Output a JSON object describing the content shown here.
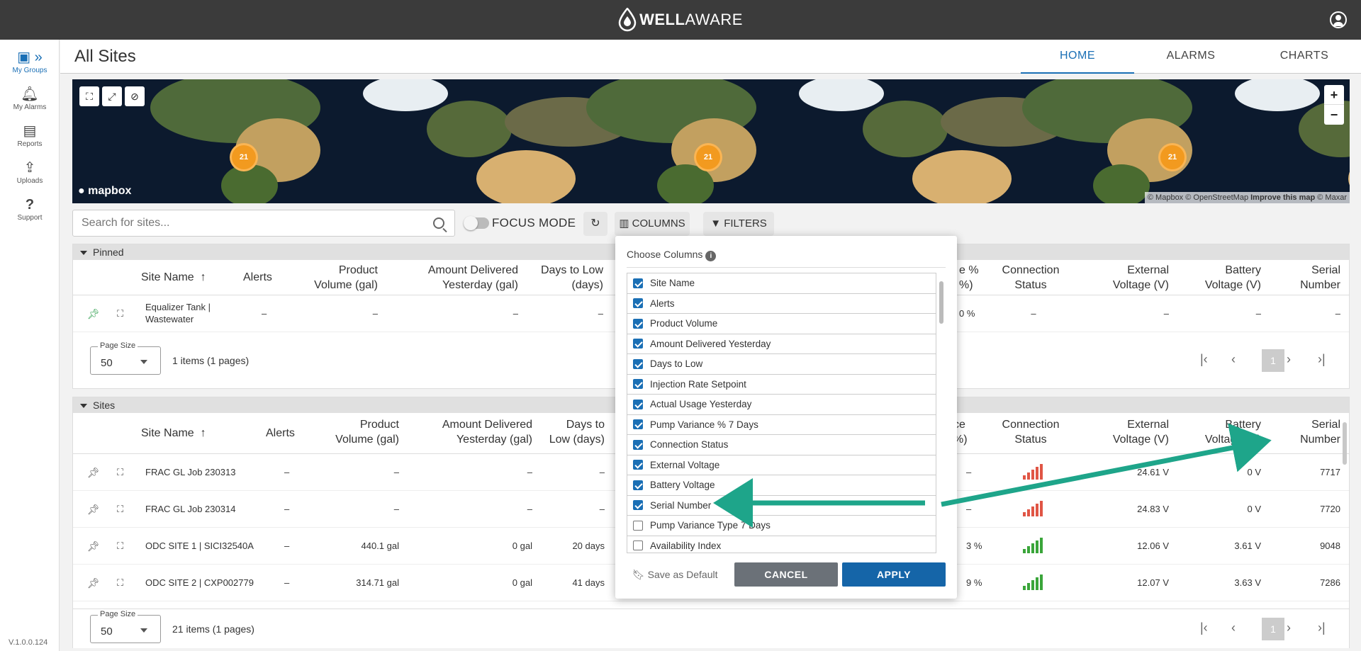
{
  "app": {
    "brand_bold": "WELL",
    "brand_light": "AWARE"
  },
  "sidebar": {
    "items": [
      {
        "label": "My Groups",
        "icon": "groups-icon"
      },
      {
        "label": "My Alarms",
        "icon": "bell-icon"
      },
      {
        "label": "Reports",
        "icon": "document-icon"
      },
      {
        "label": "Uploads",
        "icon": "upload-icon"
      },
      {
        "label": "Support",
        "icon": "question-icon"
      }
    ],
    "version": "V.1.0.0.124"
  },
  "header": {
    "title": "All Sites",
    "tabs": [
      {
        "label": "HOME",
        "active": true
      },
      {
        "label": "ALARMS",
        "active": false
      },
      {
        "label": "CHARTS",
        "active": false
      }
    ]
  },
  "map": {
    "clusters": [
      "21",
      "21",
      "21"
    ],
    "logo": "mapbox",
    "attribution_a": "© Mapbox © OpenStreetMap",
    "attribution_b": "Improve this map",
    "attribution_c": "© Maxar",
    "zoom_in": "+",
    "zoom_out": "−"
  },
  "toolbar": {
    "search_placeholder": "Search for sites...",
    "focus_mode": "FOCUS MODE",
    "columns": "COLUMNS",
    "filters": "FILTERS"
  },
  "pinned": {
    "section": "Pinned",
    "headers": {
      "site_name": "Site Name",
      "alerts": "Alerts",
      "product_volume_1": "Product",
      "product_volume_2": "Volume (gal)",
      "amount_1": "Amount Delivered",
      "amount_2": "Yesterday (gal)",
      "days_1": "Days to Low",
      "days_2": "(days)",
      "pv_1": "e %",
      "pv_2": "%)",
      "conn_1": "Connection",
      "conn_2": "Status",
      "ext_1": "External",
      "ext_2": "Voltage (V)",
      "bat_1": "Battery",
      "bat_2": "Voltage (V)",
      "serial_1": "Serial",
      "serial_2": "Number"
    },
    "rows": [
      {
        "name_1": "Equalizer Tank |",
        "name_2": "Wastewater",
        "alerts": "–",
        "volume": "–",
        "amount": "–",
        "days": "–",
        "pv": "0 %",
        "conn": "–",
        "ext": "–",
        "bat": "–",
        "serial": "–"
      }
    ],
    "page_size_label": "Page Size",
    "page_size": "50",
    "items_info": "1 items (1 pages)",
    "current_page": "1"
  },
  "sites": {
    "section": "Sites",
    "headers": {
      "site_name": "Site Name",
      "alerts": "Alerts",
      "product_volume_1": "Product",
      "product_volume_2": "Volume (gal)",
      "amount_1": "Amount Delivered",
      "amount_2": "Yesterday (gal)",
      "days_1": "Days to",
      "days_2": "Low (days)",
      "pv_1": "ce",
      "pv_2": "%)",
      "conn_1": "Connection",
      "conn_2": "Status",
      "ext_1": "External",
      "ext_2": "Voltage (V)",
      "bat_1": "Battery",
      "bat_2": "Voltage (V)",
      "serial_1": "Serial",
      "serial_2": "Number"
    },
    "rows": [
      {
        "name": "FRAC GL Job 230313",
        "alerts": "–",
        "volume": "–",
        "amount": "–",
        "days": "–",
        "pv": "–",
        "signal": "red",
        "ext": "24.61 V",
        "bat": "0 V",
        "serial": "7717"
      },
      {
        "name": "FRAC GL Job 230314",
        "alerts": "–",
        "volume": "–",
        "amount": "–",
        "days": "–",
        "pv": "–",
        "signal": "red",
        "ext": "24.83 V",
        "bat": "0 V",
        "serial": "7720"
      },
      {
        "name": "ODC SITE 1 | SICI32540A",
        "alerts": "–",
        "volume": "440.1 gal",
        "amount": "0 gal",
        "days": "20 days",
        "pv": "3 %",
        "signal": "green",
        "ext": "12.06 V",
        "bat": "3.61 V",
        "serial": "9048"
      },
      {
        "name": "ODC SITE 2 | CXP002779",
        "alerts": "–",
        "volume": "314.71 gal",
        "amount": "0 gal",
        "days": "41 days",
        "pv": "9 %",
        "signal": "green",
        "ext": "12.07 V",
        "bat": "3.63 V",
        "serial": "7286"
      }
    ],
    "page_size_label": "Page Size",
    "page_size": "50",
    "items_info": "21 items (1 pages)",
    "current_page": "1"
  },
  "choose_columns": {
    "title": "Choose Columns",
    "items": [
      {
        "label": "Site Name",
        "checked": true
      },
      {
        "label": "Alerts",
        "checked": true
      },
      {
        "label": "Product Volume",
        "checked": true
      },
      {
        "label": "Amount Delivered Yesterday",
        "checked": true
      },
      {
        "label": "Days to Low",
        "checked": true
      },
      {
        "label": "Injection Rate Setpoint",
        "checked": true
      },
      {
        "label": "Actual Usage Yesterday",
        "checked": true
      },
      {
        "label": "Pump Variance % 7 Days",
        "checked": true
      },
      {
        "label": "Connection Status",
        "checked": true
      },
      {
        "label": "External Voltage",
        "checked": true
      },
      {
        "label": "Battery Voltage",
        "checked": true
      },
      {
        "label": "Serial Number",
        "checked": true
      },
      {
        "label": "Pump Variance Type 7 Days",
        "checked": false
      },
      {
        "label": "Availability Index",
        "checked": false
      }
    ],
    "save_default": "Save as Default",
    "cancel": "CANCEL",
    "apply": "APPLY"
  },
  "colors": {
    "accent": "#1a6fb5",
    "topbar": "#3b3b3b",
    "arrow": "#1ea58a",
    "signal_red": "#e05545",
    "signal_green": "#3aa53a",
    "cluster": "#f29a1f"
  }
}
